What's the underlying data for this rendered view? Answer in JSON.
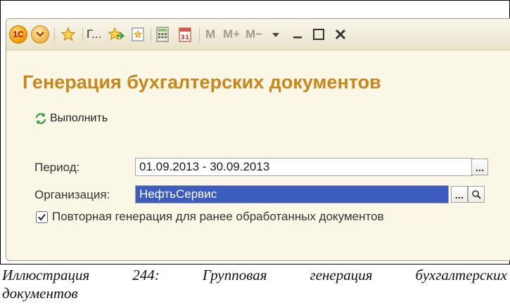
{
  "toolbar": {
    "logo_text": "1С",
    "truncated_label": "Г...",
    "mem_buttons": [
      "M",
      "M+",
      "M−"
    ],
    "icons": [
      "1c-logo-icon",
      "main-menu-icon",
      "favorites-star-icon",
      "favorites-add-icon",
      "history-icon",
      "calculator-icon",
      "calendar-icon",
      "chevron-down-icon",
      "minimize-icon",
      "maximize-icon",
      "close-icon"
    ],
    "calendar_day": "31"
  },
  "form": {
    "title": "Генерация бухгалтерских документов",
    "execute_label": "Выполнить",
    "period_label": "Период:",
    "period_value": "01.09.2013 - 30.09.2013",
    "org_label": "Организация:",
    "org_value": "НефтьСервис",
    "ellipsis": "...",
    "repeat_label": "Повторная генерация для ранее обработанных документов",
    "repeat_checked": true
  },
  "caption": {
    "words_line1": [
      "Иллюстрация",
      "244:",
      "Групповая",
      "генерация",
      "бухгалтерских"
    ],
    "line2": "документов"
  },
  "colors": {
    "title": "#c8861b",
    "selection": "#3d5cc0",
    "window_bg": "#fbf7e6"
  }
}
